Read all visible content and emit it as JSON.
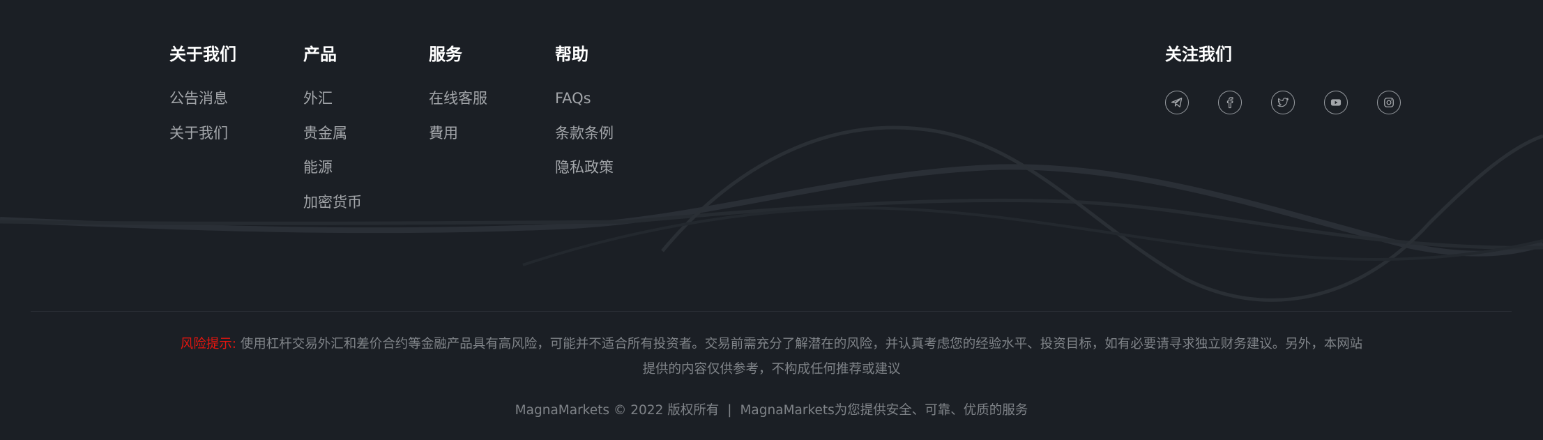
{
  "footer": {
    "columns": [
      {
        "title": "关于我们",
        "links": [
          "公告消息",
          "关于我们"
        ]
      },
      {
        "title": "产品",
        "links": [
          "外汇",
          "贵金属",
          "能源",
          "加密货币"
        ]
      },
      {
        "title": "服务",
        "links": [
          "在线客服",
          "費用"
        ]
      },
      {
        "title": "帮助",
        "links": [
          "FAQs",
          "条款条例",
          "隐私政策"
        ]
      }
    ],
    "follow": {
      "title": "关注我们",
      "icons": [
        "telegram-icon",
        "facebook-icon",
        "twitter-icon",
        "youtube-icon",
        "instagram-icon"
      ]
    },
    "risk": {
      "label": "风险提示:",
      "text": " 使用杠杆交易外汇和差价合约等金融产品具有高风险，可能并不适合所有投资者。交易前需充分了解潜在的风险，并认真考虑您的经验水平、投资目标，如有必要请寻求独立财务建议。另外，本网站提供的内容仅供参考，不构成任何推荐或建议"
    },
    "copyright": {
      "left": "MagnaMarkets © 2022 版权所有",
      "separator": "|",
      "right": "MagnaMarkets为您提供安全、可靠、优质的服务"
    }
  },
  "colors": {
    "background": "#1b1f25",
    "heading": "#ffffff",
    "link": "#a3a6aa",
    "risk_label": "#e5150f",
    "muted": "#7f8388"
  }
}
